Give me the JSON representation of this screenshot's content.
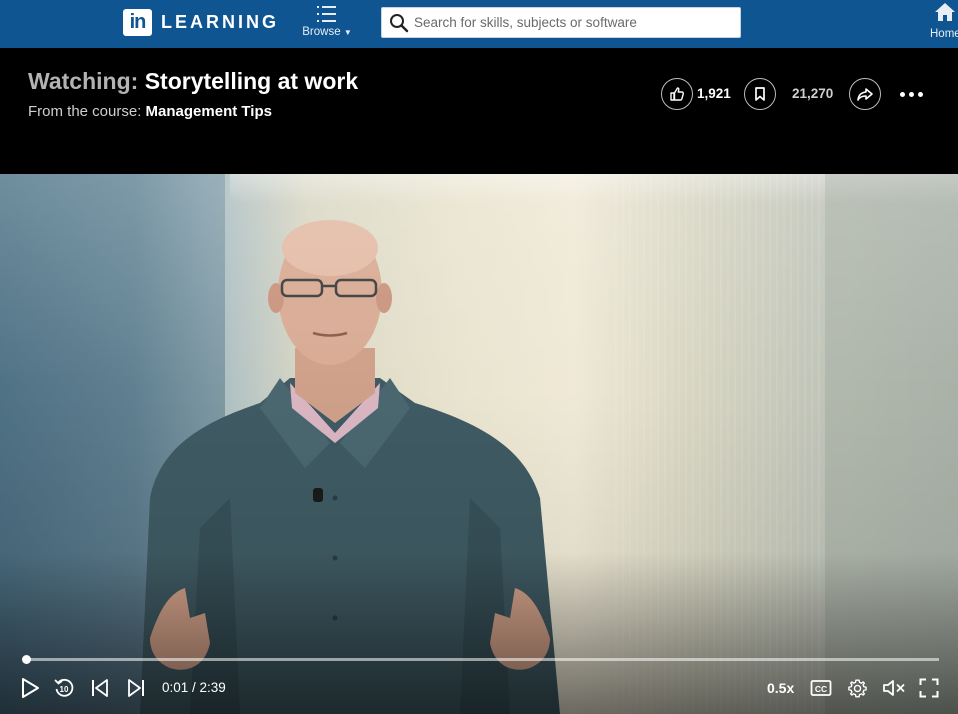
{
  "nav": {
    "logo_mark": "in",
    "logo_text": "LEARNING",
    "browse_label": "Browse",
    "search_placeholder": "Search for skills, subjects or software",
    "home_label": "Home"
  },
  "header": {
    "watching_prefix": "Watching:",
    "video_title": "Storytelling at work",
    "course_prefix": "From the course:",
    "course_name": "Management Tips"
  },
  "actions": {
    "likes": "1,921",
    "saves": "21,270",
    "like_icon": "thumbs-up-icon",
    "save_icon": "bookmark-icon",
    "share_icon": "share-icon",
    "more_icon": "more-horizontal-icon"
  },
  "player": {
    "progress": 0.0,
    "current_time": "0:01",
    "duration": "2:39",
    "time_display": "0:01 / 2:39",
    "speed": "0.5x",
    "icons": [
      "play-icon",
      "replay-10-icon",
      "previous-icon",
      "next-icon",
      "closed-captions-icon",
      "settings-icon",
      "mute-icon",
      "fullscreen-icon"
    ]
  },
  "colors": {
    "nav_bg": "#0f5591",
    "header_bg": "#000000"
  }
}
